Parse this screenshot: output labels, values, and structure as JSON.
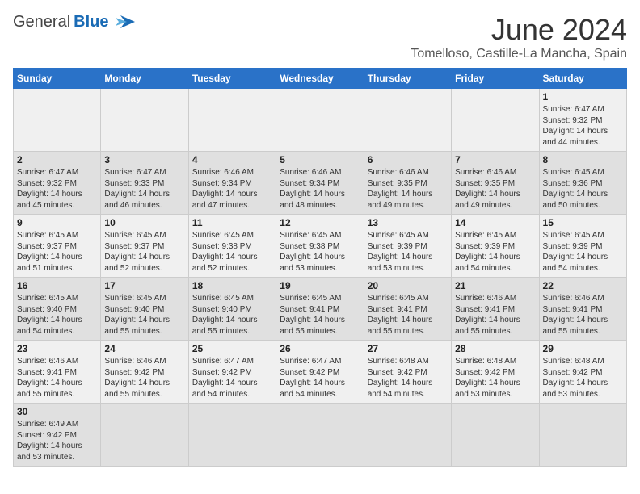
{
  "header": {
    "logo_general": "General",
    "logo_blue": "Blue",
    "month_title": "June 2024",
    "location": "Tomelloso, Castille-La Mancha, Spain"
  },
  "days_of_week": [
    "Sunday",
    "Monday",
    "Tuesday",
    "Wednesday",
    "Thursday",
    "Friday",
    "Saturday"
  ],
  "weeks": [
    [
      {
        "day": "",
        "info": ""
      },
      {
        "day": "",
        "info": ""
      },
      {
        "day": "",
        "info": ""
      },
      {
        "day": "",
        "info": ""
      },
      {
        "day": "",
        "info": ""
      },
      {
        "day": "",
        "info": ""
      },
      {
        "day": "1",
        "info": "Sunrise: 6:47 AM\nSunset: 9:32 PM\nDaylight: 14 hours\nand 44 minutes."
      }
    ],
    [
      {
        "day": "2",
        "info": "Sunrise: 6:47 AM\nSunset: 9:32 PM\nDaylight: 14 hours\nand 45 minutes."
      },
      {
        "day": "3",
        "info": "Sunrise: 6:47 AM\nSunset: 9:33 PM\nDaylight: 14 hours\nand 46 minutes."
      },
      {
        "day": "4",
        "info": "Sunrise: 6:46 AM\nSunset: 9:34 PM\nDaylight: 14 hours\nand 47 minutes."
      },
      {
        "day": "5",
        "info": "Sunrise: 6:46 AM\nSunset: 9:34 PM\nDaylight: 14 hours\nand 48 minutes."
      },
      {
        "day": "6",
        "info": "Sunrise: 6:46 AM\nSunset: 9:35 PM\nDaylight: 14 hours\nand 49 minutes."
      },
      {
        "day": "7",
        "info": "Sunrise: 6:46 AM\nSunset: 9:35 PM\nDaylight: 14 hours\nand 49 minutes."
      },
      {
        "day": "8",
        "info": "Sunrise: 6:45 AM\nSunset: 9:36 PM\nDaylight: 14 hours\nand 50 minutes."
      }
    ],
    [
      {
        "day": "9",
        "info": "Sunrise: 6:45 AM\nSunset: 9:37 PM\nDaylight: 14 hours\nand 51 minutes."
      },
      {
        "day": "10",
        "info": "Sunrise: 6:45 AM\nSunset: 9:37 PM\nDaylight: 14 hours\nand 52 minutes."
      },
      {
        "day": "11",
        "info": "Sunrise: 6:45 AM\nSunset: 9:38 PM\nDaylight: 14 hours\nand 52 minutes."
      },
      {
        "day": "12",
        "info": "Sunrise: 6:45 AM\nSunset: 9:38 PM\nDaylight: 14 hours\nand 53 minutes."
      },
      {
        "day": "13",
        "info": "Sunrise: 6:45 AM\nSunset: 9:39 PM\nDaylight: 14 hours\nand 53 minutes."
      },
      {
        "day": "14",
        "info": "Sunrise: 6:45 AM\nSunset: 9:39 PM\nDaylight: 14 hours\nand 54 minutes."
      },
      {
        "day": "15",
        "info": "Sunrise: 6:45 AM\nSunset: 9:39 PM\nDaylight: 14 hours\nand 54 minutes."
      }
    ],
    [
      {
        "day": "16",
        "info": "Sunrise: 6:45 AM\nSunset: 9:40 PM\nDaylight: 14 hours\nand 54 minutes."
      },
      {
        "day": "17",
        "info": "Sunrise: 6:45 AM\nSunset: 9:40 PM\nDaylight: 14 hours\nand 55 minutes."
      },
      {
        "day": "18",
        "info": "Sunrise: 6:45 AM\nSunset: 9:40 PM\nDaylight: 14 hours\nand 55 minutes."
      },
      {
        "day": "19",
        "info": "Sunrise: 6:45 AM\nSunset: 9:41 PM\nDaylight: 14 hours\nand 55 minutes."
      },
      {
        "day": "20",
        "info": "Sunrise: 6:45 AM\nSunset: 9:41 PM\nDaylight: 14 hours\nand 55 minutes."
      },
      {
        "day": "21",
        "info": "Sunrise: 6:46 AM\nSunset: 9:41 PM\nDaylight: 14 hours\nand 55 minutes."
      },
      {
        "day": "22",
        "info": "Sunrise: 6:46 AM\nSunset: 9:41 PM\nDaylight: 14 hours\nand 55 minutes."
      }
    ],
    [
      {
        "day": "23",
        "info": "Sunrise: 6:46 AM\nSunset: 9:41 PM\nDaylight: 14 hours\nand 55 minutes."
      },
      {
        "day": "24",
        "info": "Sunrise: 6:46 AM\nSunset: 9:42 PM\nDaylight: 14 hours\nand 55 minutes."
      },
      {
        "day": "25",
        "info": "Sunrise: 6:47 AM\nSunset: 9:42 PM\nDaylight: 14 hours\nand 54 minutes."
      },
      {
        "day": "26",
        "info": "Sunrise: 6:47 AM\nSunset: 9:42 PM\nDaylight: 14 hours\nand 54 minutes."
      },
      {
        "day": "27",
        "info": "Sunrise: 6:48 AM\nSunset: 9:42 PM\nDaylight: 14 hours\nand 54 minutes."
      },
      {
        "day": "28",
        "info": "Sunrise: 6:48 AM\nSunset: 9:42 PM\nDaylight: 14 hours\nand 53 minutes."
      },
      {
        "day": "29",
        "info": "Sunrise: 6:48 AM\nSunset: 9:42 PM\nDaylight: 14 hours\nand 53 minutes."
      }
    ],
    [
      {
        "day": "30",
        "info": "Sunrise: 6:49 AM\nSunset: 9:42 PM\nDaylight: 14 hours\nand 53 minutes."
      },
      {
        "day": "",
        "info": ""
      },
      {
        "day": "",
        "info": ""
      },
      {
        "day": "",
        "info": ""
      },
      {
        "day": "",
        "info": ""
      },
      {
        "day": "",
        "info": ""
      },
      {
        "day": "",
        "info": ""
      }
    ]
  ]
}
